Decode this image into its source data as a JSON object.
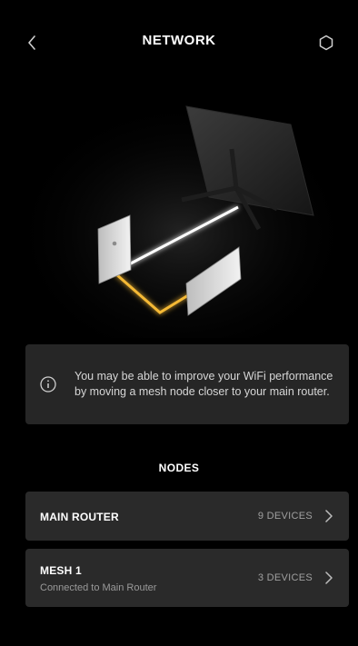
{
  "header": {
    "title": "NETWORK",
    "back_icon": "chevron-left-icon",
    "settings_icon": "gear-icon"
  },
  "info": {
    "icon": "info-icon",
    "message": "You may be able to improve your WiFi performance by moving a mesh node closer to your main router."
  },
  "nodes": {
    "title": "NODES",
    "items": [
      {
        "name": "MAIN ROUTER",
        "subtitle": "",
        "devices": "9 DEVICES"
      },
      {
        "name": "MESH 1",
        "subtitle": "Connected to Main Router",
        "devices": "3 DEVICES"
      }
    ]
  },
  "colors": {
    "background": "#000000",
    "card": "#262626",
    "link_glow_white": "#ffffff",
    "link_glow_amber": "#f5b936"
  }
}
